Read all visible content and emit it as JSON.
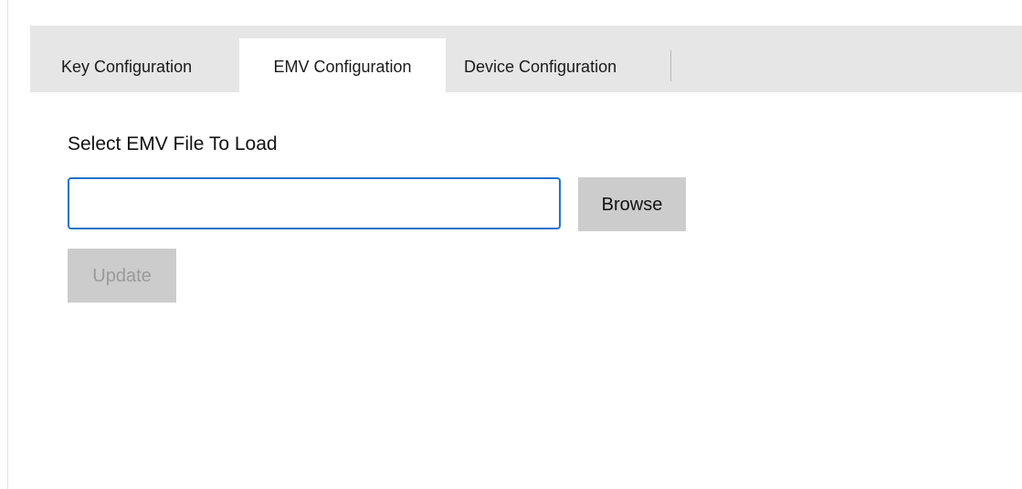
{
  "tabs": [
    {
      "label": "Key Configuration",
      "selected": false
    },
    {
      "label": "EMV Configuration",
      "selected": true
    },
    {
      "label": "Device Configuration",
      "selected": false
    }
  ],
  "main": {
    "section_label": "Select EMV File To Load",
    "file_input": {
      "value": "",
      "placeholder": ""
    },
    "browse_label": "Browse",
    "update_label": "Update",
    "update_enabled": false
  },
  "colors": {
    "tab_strip": "#e6e6e6",
    "active_tab": "#ffffff",
    "input_border": "#1e73c8",
    "button_bg": "#cccccc",
    "disabled_text": "#9a9a9a"
  }
}
